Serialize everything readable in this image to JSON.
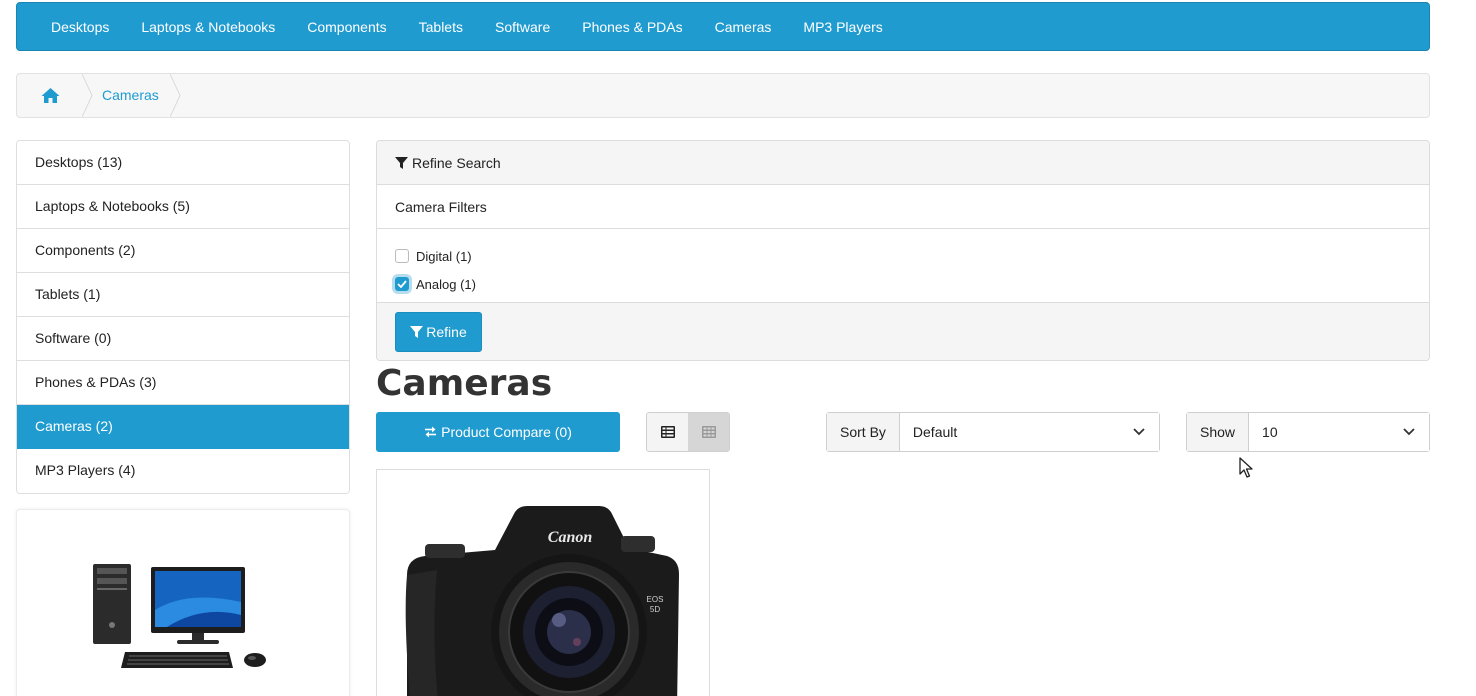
{
  "topnav": {
    "items": [
      "Desktops",
      "Laptops & Notebooks",
      "Components",
      "Tablets",
      "Software",
      "Phones & PDAs",
      "Cameras",
      "MP3 Players"
    ]
  },
  "breadcrumb": {
    "home_icon": "home-icon",
    "current": "Cameras"
  },
  "sidebar": {
    "items": [
      {
        "label": "Desktops (13)",
        "active": false
      },
      {
        "label": "Laptops & Notebooks (5)",
        "active": false
      },
      {
        "label": "Components (2)",
        "active": false
      },
      {
        "label": "Tablets (1)",
        "active": false
      },
      {
        "label": "Software (0)",
        "active": false
      },
      {
        "label": "Phones & PDAs (3)",
        "active": false
      },
      {
        "label": "Cameras (2)",
        "active": true
      },
      {
        "label": "MP3 Players (4)",
        "active": false
      }
    ]
  },
  "refine": {
    "title": "Refine Search",
    "group_name": "Camera Filters",
    "filters": [
      {
        "label": "Digital (1)",
        "checked": false
      },
      {
        "label": "Analog (1)",
        "checked": true
      }
    ],
    "button": "Refine"
  },
  "main": {
    "title": "Cameras",
    "compare_label": "Product Compare (0)",
    "sort_label": "Sort By",
    "sort_value": "Default",
    "show_label": "Show",
    "show_value": "10"
  },
  "colors": {
    "accent": "#1f9bcf",
    "panel_bg": "#f5f5f6",
    "border": "#dcdcdc"
  }
}
